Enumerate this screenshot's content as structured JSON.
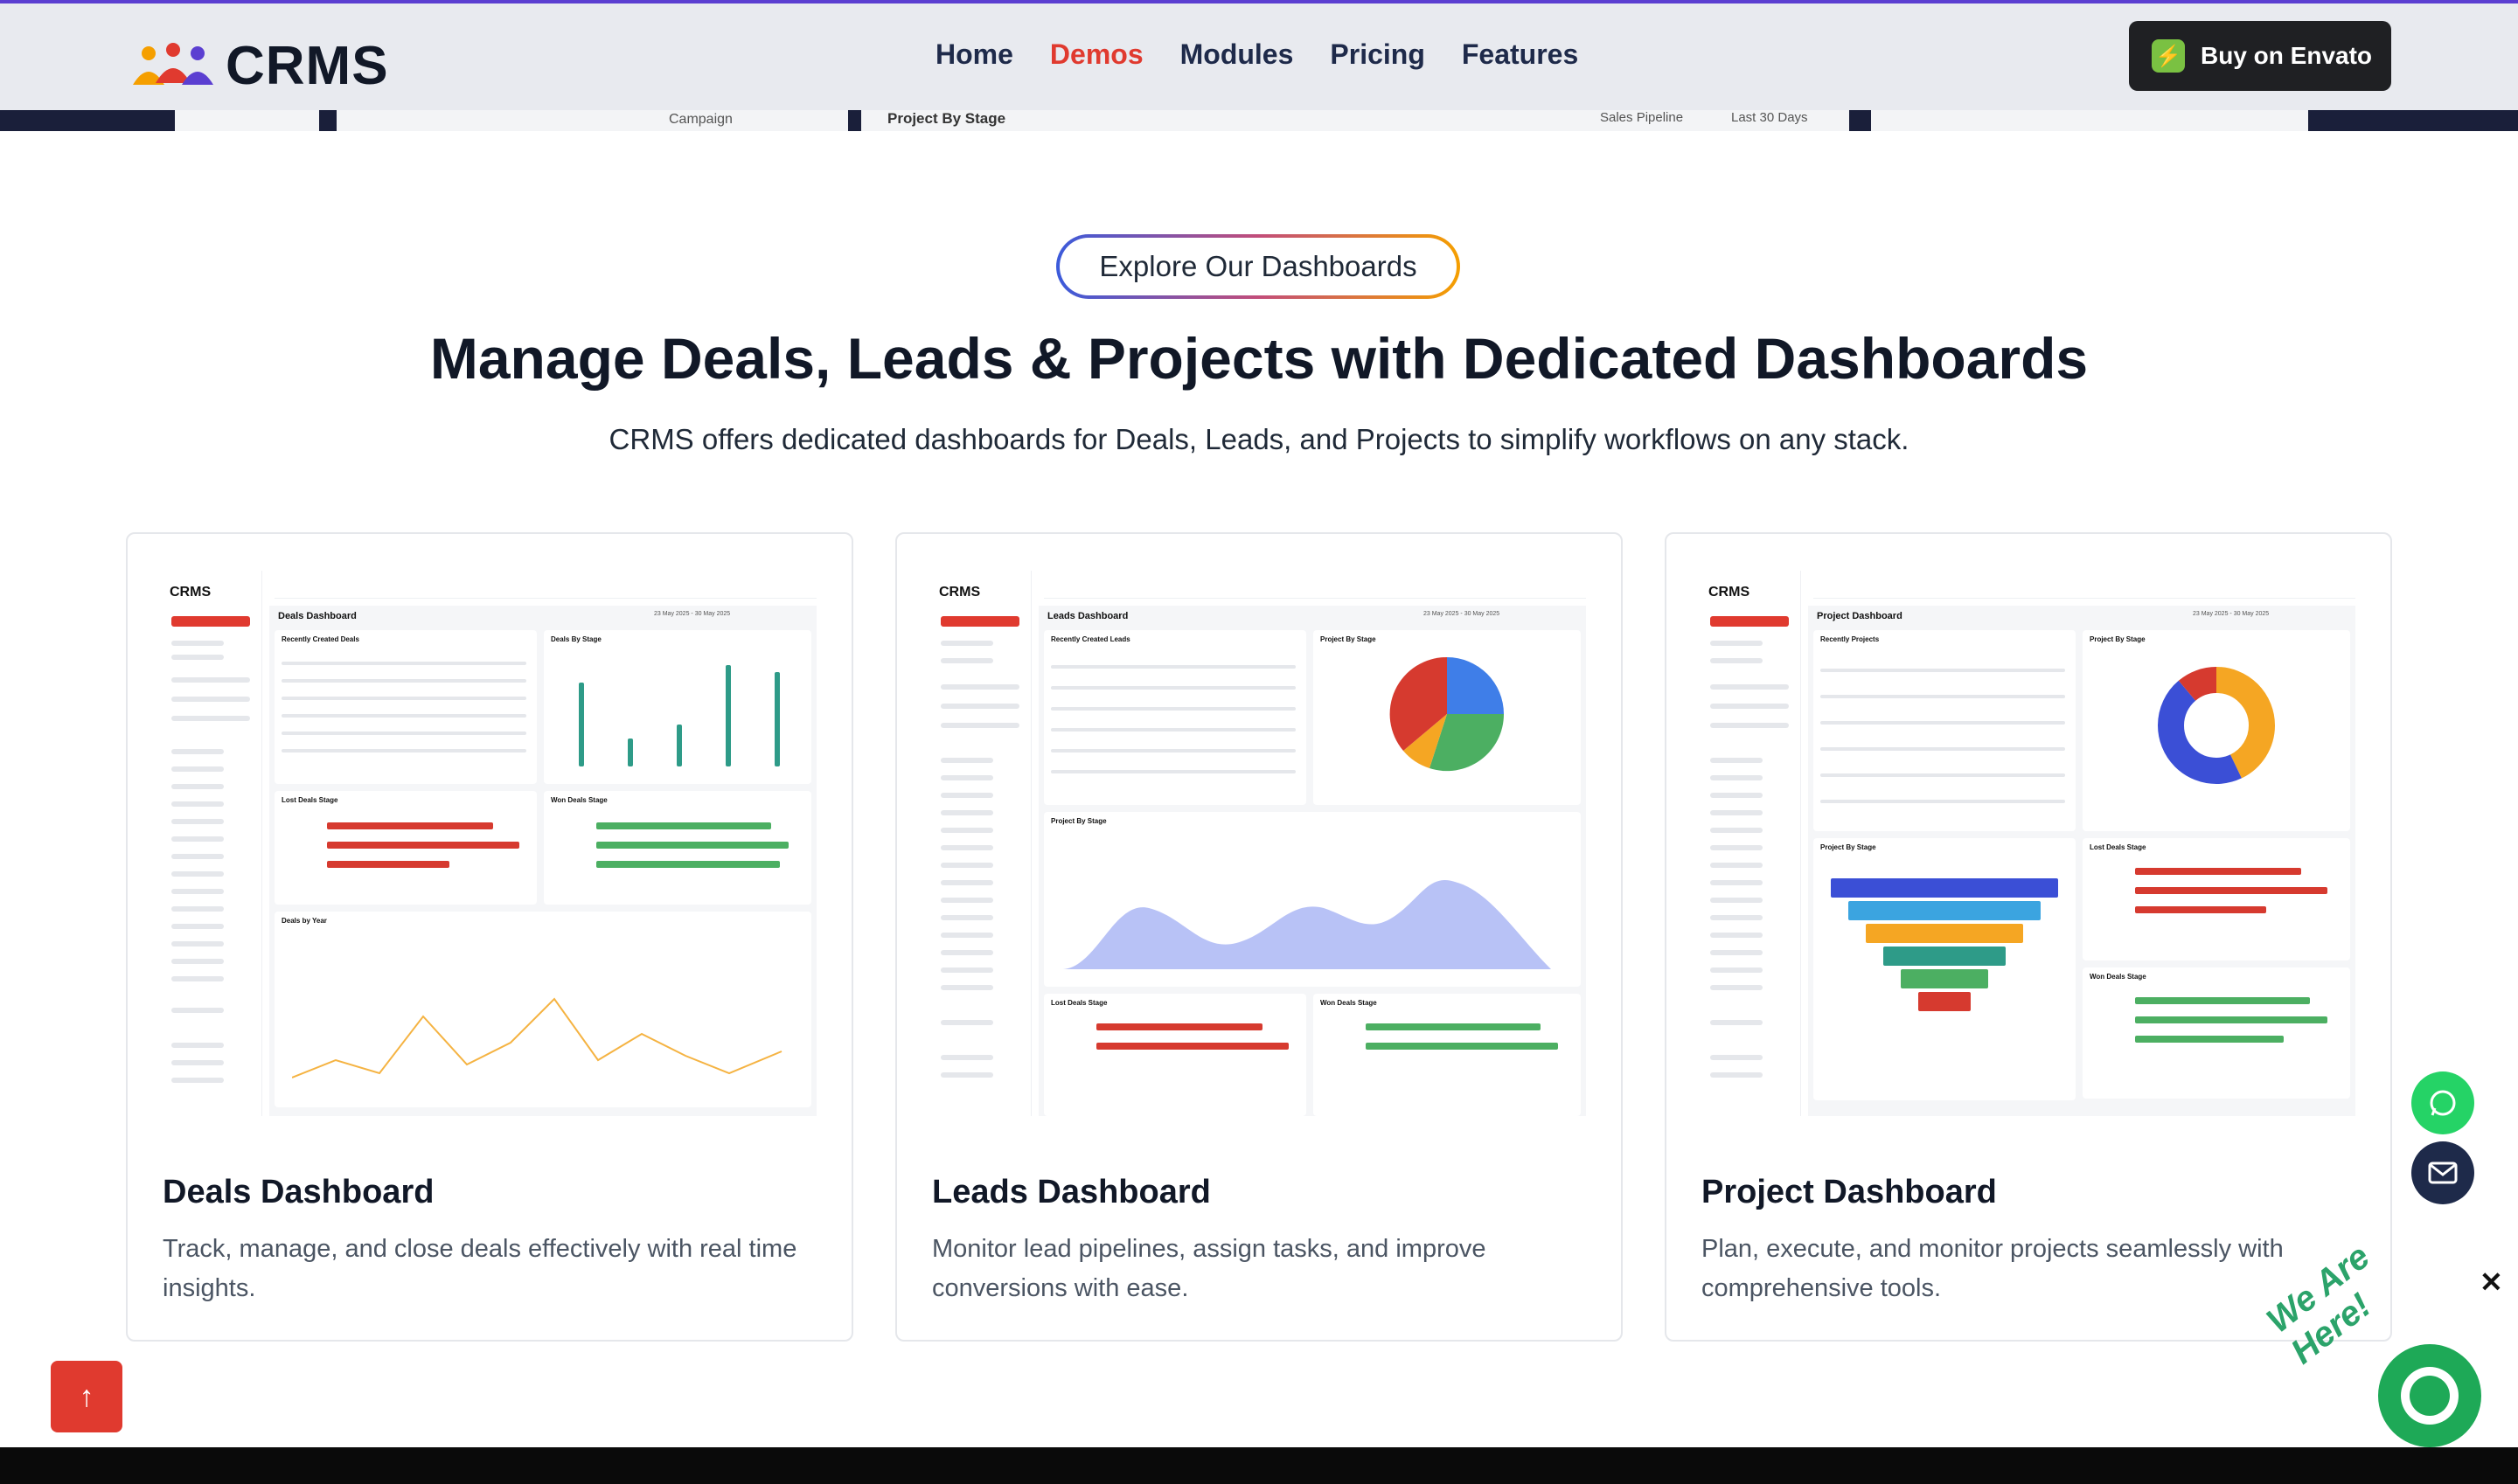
{
  "header": {
    "logo_text": "CRMS",
    "nav": [
      "Home",
      "Demos",
      "Modules",
      "Pricing",
      "Features"
    ],
    "active_nav": "Demos",
    "buy_label": "Buy on Envato",
    "peek_left": "Campaign",
    "peek_center": "Project By Stage",
    "peek_filter_1": "Sales Pipeline",
    "peek_filter_2": "Last 30 Days"
  },
  "section": {
    "pill": "Explore Our Dashboards",
    "title": "Manage Deals, Leads & Projects with Dedicated Dashboards",
    "subtitle": "CRMS offers dedicated dashboards for Deals, Leads, and Projects to simplify workflows on any stack."
  },
  "cards": [
    {
      "title": "Deals Dashboard",
      "desc": "Track, manage, and close deals effectively with real time insights.",
      "thumb_heading": "Deals Dashboard",
      "panel_1": "Recently Created Deals",
      "panel_2": "Deals By Stage",
      "panel_3": "Lost Deals Stage",
      "panel_4": "Won Deals Stage",
      "panel_5": "Deals by Year"
    },
    {
      "title": "Leads Dashboard",
      "desc": "Monitor lead pipelines, assign tasks, and improve conversions with ease.",
      "thumb_heading": "Leads Dashboard",
      "panel_1": "Recently Created Leads",
      "panel_2": "Project By Stage",
      "panel_3": "Project By Stage",
      "panel_4": "Lost Deals Stage",
      "panel_5": "Won Deals Stage"
    },
    {
      "title": "Project Dashboard",
      "desc": "Plan, execute, and monitor projects seamlessly with comprehensive tools.",
      "thumb_heading": "Project Dashboard",
      "panel_1": "Recently Projects",
      "panel_2": "Project By Stage",
      "panel_3": "Project By Stage",
      "panel_4": "Lost Deals Stage",
      "panel_5": "Won Deals Stage"
    }
  ],
  "thumb_common": {
    "logo": "CRMS",
    "date_range": "23 May 2025 - 30 May 2025"
  },
  "floating": {
    "we_are_here": "We Are Here!",
    "close": "✕",
    "scroll_top": "↑"
  },
  "colors": {
    "accent_red": "#e03a2f",
    "navy": "#1e2a4a",
    "green": "#25d366",
    "dark_button": "#1f2023"
  }
}
